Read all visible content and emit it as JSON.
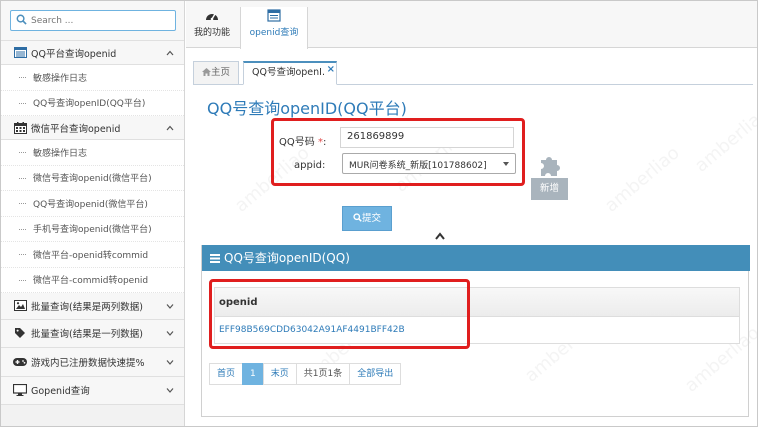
{
  "sidebar": {
    "search_placeholder": "Search ...",
    "groups": [
      {
        "label": "QQ平台查询openid",
        "icon": "list-icon",
        "items": [
          "敏感操作日志",
          "QQ号查询openID(QQ平台)"
        ]
      },
      {
        "label": "微信平台查询openid",
        "icon": "calendar-icon",
        "items": [
          "敏感操作日志",
          "微信号查询openid(微信平台)",
          "QQ号查询openid(微信平台)",
          "手机号查询openid(微信平台)",
          "微信平台-openid转commid",
          "微信平台-commid转openid"
        ]
      },
      {
        "label": "批量查询(结果是两列数据)",
        "icon": "picture-icon"
      },
      {
        "label": "批量查询(结果是一列数据)",
        "icon": "tag-icon"
      },
      {
        "label": "游戏内已注册数据快速提%",
        "icon": "gamepad-icon"
      },
      {
        "label": "Gopenid查询",
        "icon": "desktop-icon"
      }
    ]
  },
  "topbar": {
    "tabs": [
      {
        "label": "我的功能",
        "icon": "dashboard-icon"
      },
      {
        "label": "openid查询",
        "icon": "list-icon"
      }
    ]
  },
  "page_tabs": {
    "home": "主页",
    "current": "QQ号查询openI."
  },
  "page_title": "QQ号查询openID(QQ平台)",
  "form": {
    "qq_label": "QQ号码",
    "required_mark": "*",
    "qq_colon": ":",
    "qq_value": "261869899",
    "appid_label": "appid:",
    "appid_value": "MUR问卷系统_新版[101788602]"
  },
  "buttons": {
    "add": "新增",
    "submit": "提交"
  },
  "result": {
    "title": "QQ号查询openID(QQ)",
    "column": "openid",
    "rows": [
      "EFF98B569CDD63042A91AF4491BFF42B"
    ]
  },
  "pager": {
    "first": "首页",
    "current": "1",
    "last": "末页",
    "summary": "共1页1条",
    "export": "全部导出"
  },
  "watermark": "amberliao",
  "colors": {
    "accent": "#438eb9",
    "link": "#2e7bb8",
    "highlight": "#e01e1e",
    "button": "#6fb3e0"
  }
}
